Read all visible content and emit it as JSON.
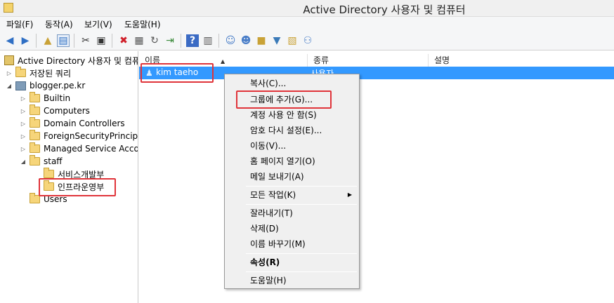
{
  "window": {
    "title": "Active Directory 사용자 및 컴퓨터"
  },
  "menu": [
    "파일(F)",
    "동작(A)",
    "보기(V)",
    "도움말(H)"
  ],
  "toolbar_icons": [
    "back-arrow-icon",
    "forward-arrow-icon",
    "up-folder-icon",
    "console-tree-icon",
    "cut-icon",
    "copy-icon",
    "delete-icon",
    "properties-icon",
    "refresh-icon",
    "export-icon",
    "help-icon",
    "mmc-icon",
    "new-user-icon",
    "new-group-icon",
    "new-ou-icon",
    "filter-icon",
    "find-icon",
    "add-to-group-icon"
  ],
  "tree": {
    "root": "Active Directory 사용자 및 컴퓨터",
    "saved_queries": "저장된 쿼리",
    "domain": "blogger.pe.kr",
    "nodes": [
      "Builtin",
      "Computers",
      "Domain Controllers",
      "ForeignSecurityPrincipals",
      "Managed Service Accounts"
    ],
    "staff": "staff",
    "staff_children": [
      "서비스개발부",
      "인프라운영부"
    ],
    "users": "Users"
  },
  "list": {
    "columns": [
      "이름",
      "종류",
      "설명"
    ],
    "rows": [
      {
        "name": "kim taeho",
        "type": "사용자"
      }
    ]
  },
  "context_menu": {
    "copy": "복사(C)...",
    "add_to_group": "그룹에 추가(G)...",
    "disable_account": "계정 사용 안 함(S)",
    "reset_password": "암호 다시 설정(E)...",
    "move": "이동(V)...",
    "open_home_page": "홈 페이지 열기(O)",
    "send_mail": "메일 보내기(A)",
    "all_tasks": "모든 작업(K)",
    "cut": "잘라내기(T)",
    "delete": "삭제(D)",
    "rename": "이름 바꾸기(M)",
    "properties": "속성(R)",
    "help": "도움말(H)"
  },
  "colors": {
    "selection": "#3399ff",
    "highlight_box": "#e0343a"
  }
}
